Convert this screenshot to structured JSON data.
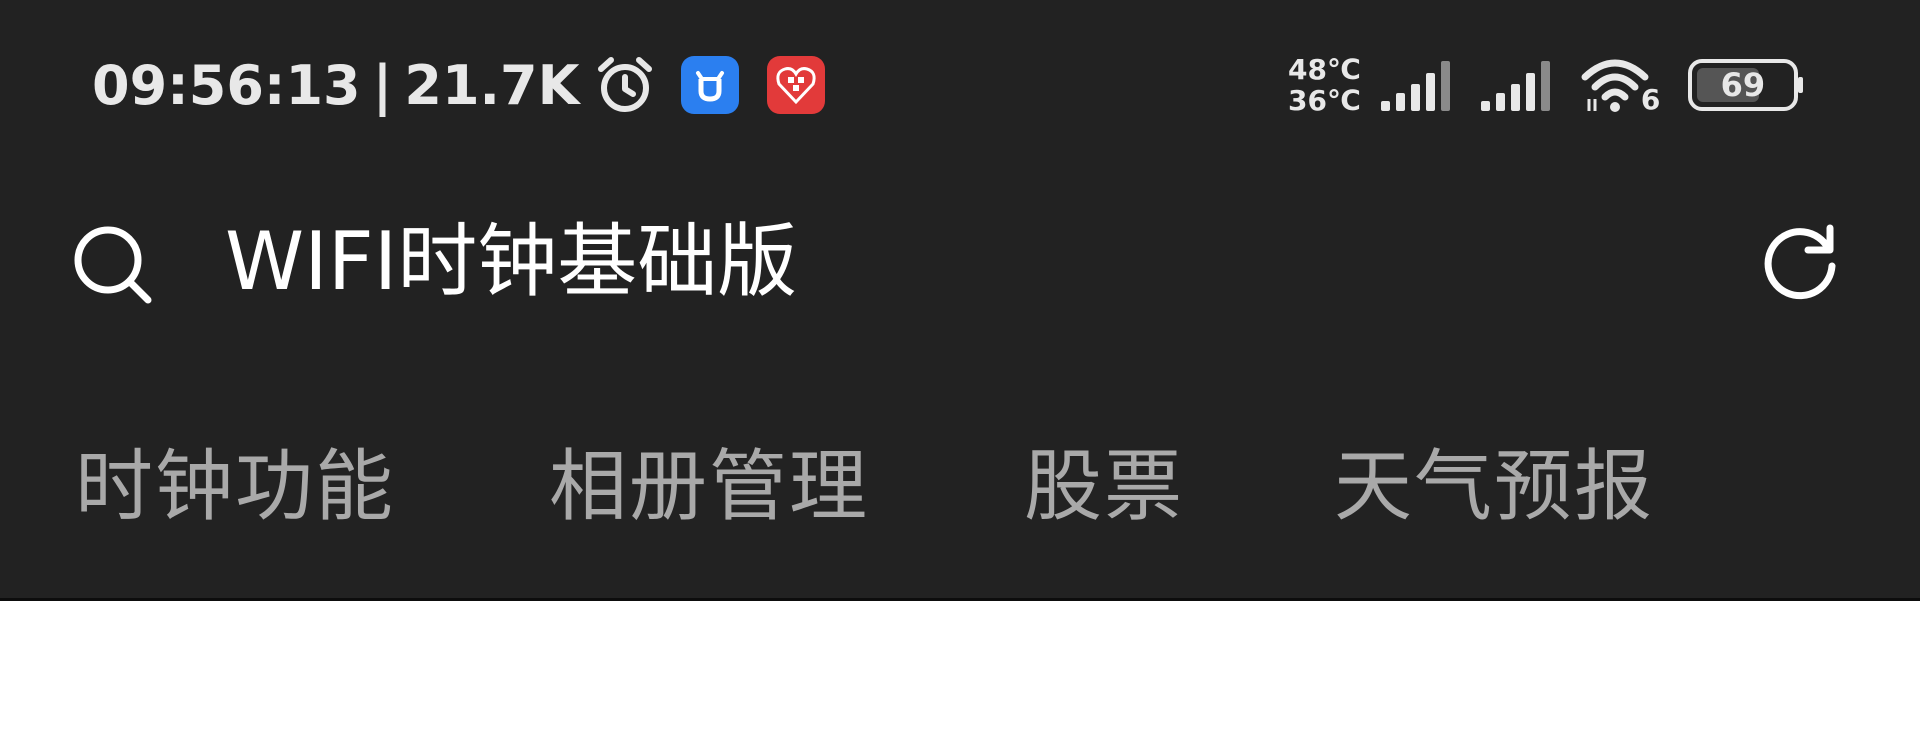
{
  "status_bar": {
    "time": "09:56:13",
    "separator": "|",
    "net_speed": "21.7K",
    "icons": [
      "alarm-clock-icon",
      "blue-app-icon",
      "red-app-icon",
      "signal-icon",
      "signal-icon",
      "wifi-icon",
      "battery-icon"
    ],
    "temp_high": "48℃",
    "temp_low": "36℃",
    "wifi_label": "6",
    "battery_level": "69"
  },
  "header": {
    "title": "WIFI时钟基础版"
  },
  "tabs": [
    {
      "label": "时钟功能"
    },
    {
      "label": "相册管理"
    },
    {
      "label": "股票"
    },
    {
      "label": "天气预报"
    }
  ],
  "colors": {
    "background_dark": "#222222",
    "content_background": "#ffffff",
    "title_text": "#ffffff",
    "tab_text": "#a9a9a9",
    "status_text": "#e8e8e8",
    "blue_app": "#2b7ff0",
    "red_app": "#e23a3a"
  }
}
